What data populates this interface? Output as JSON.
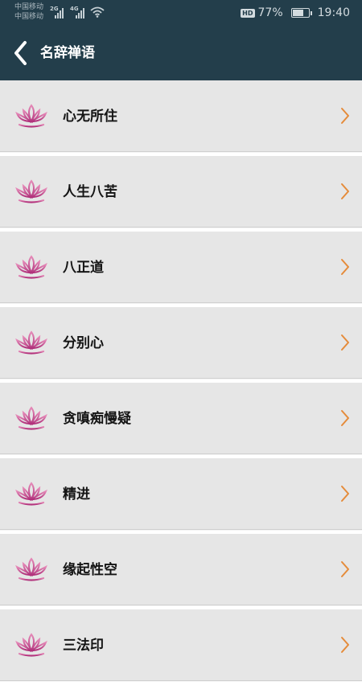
{
  "status_bar": {
    "carrier_1": "中国移动",
    "carrier_2": "中国移动",
    "network_1": "2G",
    "network_2": "4G",
    "hd": "HD",
    "battery_percent": "77%",
    "battery_level": 0.77,
    "time": "19:40"
  },
  "header": {
    "title": "名辞禅语",
    "back_icon": "chevron-left-icon",
    "background_color": "#233e4b"
  },
  "list": {
    "item_icon": "lotus-icon",
    "chevron_icon": "chevron-right-icon",
    "chevron_color": "#e58b3a",
    "items": [
      {
        "label": "心无所住"
      },
      {
        "label": "人生八苦"
      },
      {
        "label": "八正道"
      },
      {
        "label": "分别心"
      },
      {
        "label": "贪嗔痴慢疑"
      },
      {
        "label": "精进"
      },
      {
        "label": "缘起性空"
      },
      {
        "label": "三法印"
      }
    ]
  }
}
